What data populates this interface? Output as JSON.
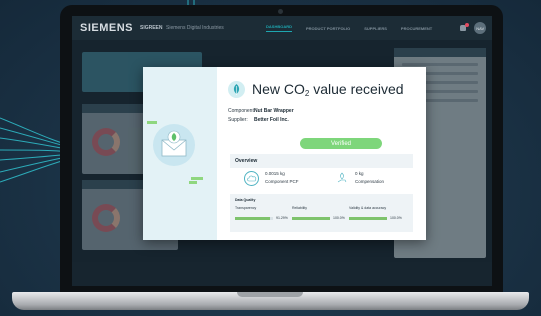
{
  "app": {
    "brand": "SIEMENS",
    "product": "SIGREEN",
    "company": "Siemens Digital Industries",
    "nav": [
      "DASHBOARD",
      "PRODUCT PORTFOLIO",
      "SUPPLIERS",
      "PROCUREMENT"
    ],
    "active_nav": "DASHBOARD",
    "avatar_initials": "NAV"
  },
  "modal": {
    "title_prefix": "New CO",
    "title_sub": "2",
    "title_suffix": " value received",
    "component_label": "Component:",
    "component_value": "Nut Bar Wrapper",
    "supplier_label": "Supplier:",
    "supplier_value": "Better Foil Inc.",
    "status_button": "Verified",
    "overview_title": "Overview",
    "metric1_value": "0.0015 kg",
    "metric1_label": "Component PCF",
    "metric1_icon": "cloud-co2-icon",
    "metric2_value": "0 kg",
    "metric2_label": "Compensation",
    "metric2_icon": "leaf-hand-icon",
    "data_quality_title": "Data Quality",
    "dq": [
      {
        "label": "Transparency",
        "value": "91.29%",
        "fraction": 0.913
      },
      {
        "label": "Reliability",
        "value": "100.0%",
        "fraction": 1.0
      },
      {
        "label": "Validity & data accuracy",
        "value": "100.0%",
        "fraction": 1.0
      }
    ]
  },
  "colors": {
    "accent": "#1ea7b1",
    "verified": "#7ed67b",
    "bar_fill": "#7ec36c"
  }
}
